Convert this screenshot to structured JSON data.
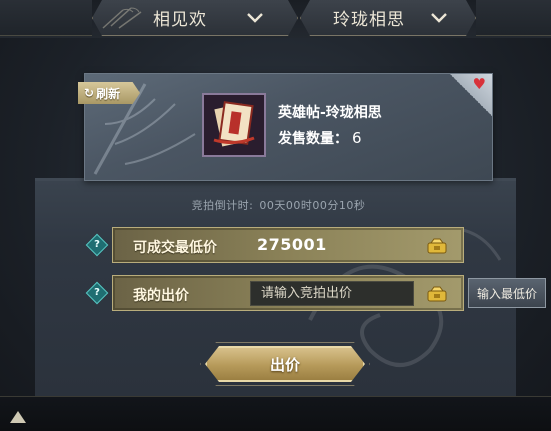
{
  "tabs": {
    "server": {
      "label": "相见欢"
    },
    "category": {
      "label": "玲珑相思"
    }
  },
  "item": {
    "refresh_label": "刷新",
    "name": "英雄帖-玲珑相思",
    "sale_label": "发售数量：",
    "sale_count": "6"
  },
  "auction": {
    "countdown_label": "竞拍倒计时:",
    "countdown_value": "00天00时00分10秒",
    "min_price_label": "可成交最低价",
    "min_price_value": "275001",
    "my_bid_label": "我的出价",
    "my_bid_placeholder": "请输入竞拍出价",
    "min_input_button": "输入最低价",
    "bid_button": "出价",
    "help_glyph": "?"
  },
  "colors": {
    "accent_gold": "#b69a5a",
    "heart": "#d8323a",
    "help_teal": "#1f6e72"
  }
}
